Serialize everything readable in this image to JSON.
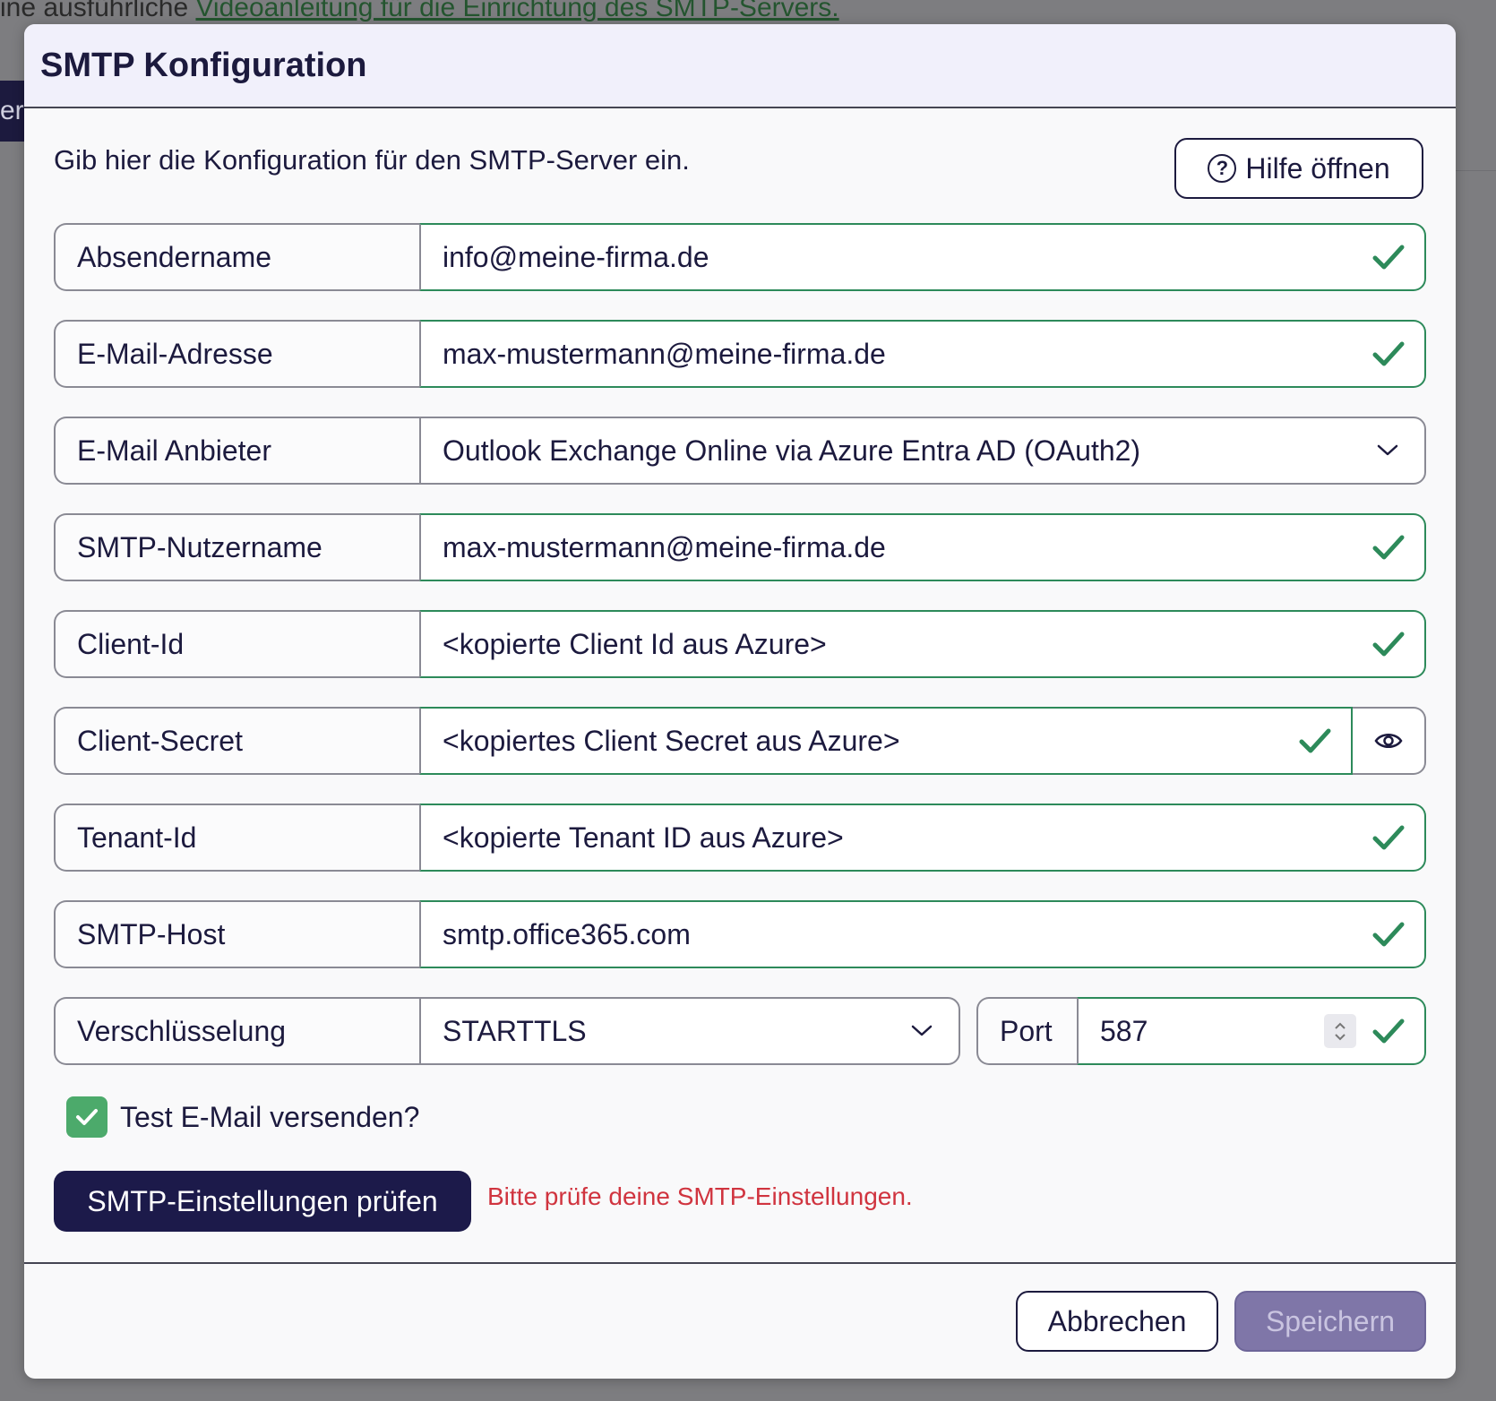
{
  "background": {
    "text_prefix": "ine ausführliche ",
    "link_text": "Videoanleitung für die Einrichtung des SMTP-Servers.",
    "tab_text": "er"
  },
  "modal": {
    "title": "SMTP Konfiguration",
    "intro": "Gib hier die Konfiguration für den SMTP-Server ein.",
    "help_button": "Hilfe öffnen",
    "help_icon_glyph": "?",
    "fields": [
      {
        "label": "Absendername",
        "value": "info@meine-firma.de"
      },
      {
        "label": "E-Mail-Adresse",
        "value": "max-mustermann@meine-firma.de"
      },
      {
        "label": "E-Mail Anbieter",
        "value": "Outlook Exchange Online via Azure Entra AD (OAuth2)"
      },
      {
        "label": "SMTP-Nutzername",
        "value": "max-mustermann@meine-firma.de"
      },
      {
        "label": "Client-Id",
        "value": "<kopierte Client Id aus Azure>"
      },
      {
        "label": "Client-Secret",
        "value": "<kopiertes Client Secret aus Azure>"
      },
      {
        "label": "Tenant-Id",
        "value": "<kopierte Tenant ID aus Azure>"
      },
      {
        "label": "SMTP-Host",
        "value": "smtp.office365.com"
      }
    ],
    "encryption": {
      "label": "Verschlüsselung",
      "value": "STARTTLS"
    },
    "port": {
      "label": "Port",
      "value": "587"
    },
    "test_email": {
      "label": "Test E-Mail versenden?",
      "checked": true
    },
    "check_button": "SMTP-Einstellungen prüfen",
    "error_message": "Bitte prüfe deine SMTP-Einstellungen.",
    "cancel_button": "Abbrechen",
    "save_button": "Speichern"
  },
  "colors": {
    "primary": "#1c1a4a",
    "valid": "#2d8a5a",
    "error": "#d0343f",
    "checkbox": "#4caa6b"
  }
}
